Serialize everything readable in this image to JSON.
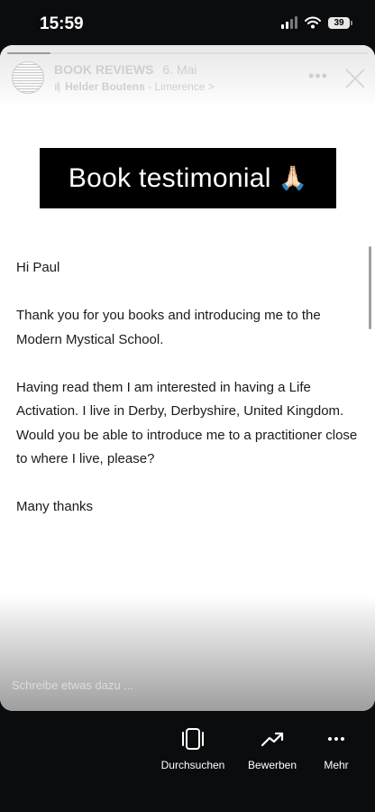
{
  "status_bar": {
    "time": "15:59",
    "battery": "39"
  },
  "story": {
    "account": "BOOK REVIEWS",
    "date": "6. Mai",
    "music_artist": "Helder Boutens",
    "music_separator": " - ",
    "music_title": "Limerence",
    "music_chevron": ">",
    "progress": 0.12
  },
  "banner": {
    "text": "Book testimonial",
    "emoji": "🙏🏻"
  },
  "letter": {
    "paragraphs": [
      "Hi Paul",
      "Thank you for you books and introducing me to the Modern Mystical School.",
      "Having read them I am interested in having a Life Activation.  I live in Derby, Derbyshire, United Kingdom.  Would you be able to introduce me to a practitioner close to where I live, please?",
      "Many thanks"
    ]
  },
  "reply": {
    "placeholder": "Schreibe etwas dazu ..."
  },
  "actions": [
    {
      "label": "Durchsuchen",
      "icon": "browse-icon"
    },
    {
      "label": "Bewerben",
      "icon": "trend-icon"
    },
    {
      "label": "Mehr",
      "icon": "more-icon"
    }
  ]
}
